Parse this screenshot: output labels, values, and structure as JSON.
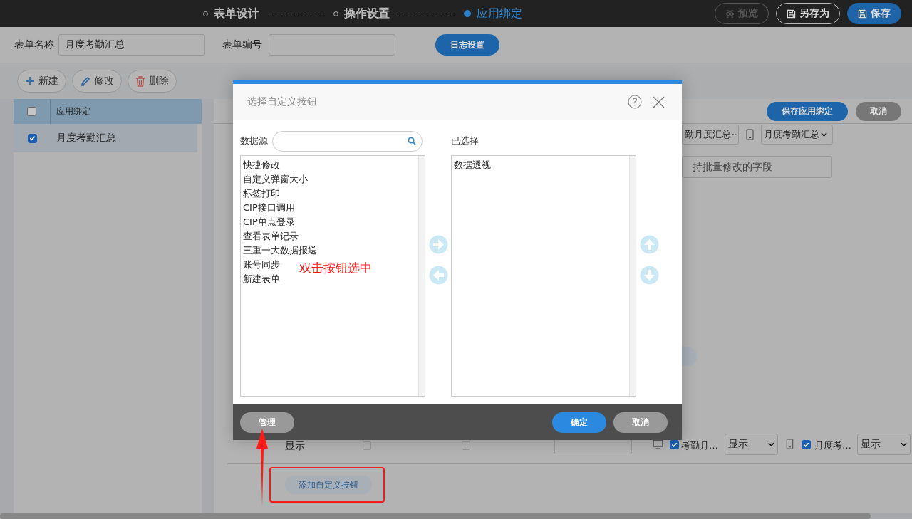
{
  "steps": [
    {
      "label": "表单设计",
      "selected": false
    },
    {
      "label": "操作设置",
      "selected": false
    },
    {
      "label": "应用绑定",
      "selected": true
    }
  ],
  "top_buttons": [
    {
      "kind": "preview",
      "label": "预览",
      "disabled": true
    },
    {
      "kind": "save-as",
      "label": "另存为",
      "disabled": false
    },
    {
      "kind": "save",
      "label": "保存",
      "disabled": false
    }
  ],
  "form": {
    "name_label": "表单名称",
    "name_value": "月度考勤汇总",
    "code_label": "表单编号",
    "log_button": "日志设置"
  },
  "toolbar": [
    {
      "kind": "add",
      "label": "新建"
    },
    {
      "kind": "edit",
      "label": "修改"
    },
    {
      "kind": "delete",
      "label": "删除"
    }
  ],
  "list": {
    "header": "应用绑定",
    "header_checked": false,
    "rows": [
      {
        "label": "月度考勤汇总",
        "checked": true
      }
    ]
  },
  "panel": {
    "buttons": [
      {
        "kind": "primary",
        "label": "保存应用绑定"
      },
      {
        "kind": "secondary",
        "label": "取消"
      }
    ],
    "pc_select": "勤月度汇总",
    "mobile_select": "月度考勤汇总",
    "batch_field": "持批量修改的字段",
    "row": {
      "label": "显示",
      "check_1": false,
      "check_2": false,
      "pc_checked": true,
      "pc_name": "考勤月…",
      "pc_display": "显示",
      "mobile_checked": true,
      "mobile_name": "月度考…",
      "mobile_display": "显示"
    },
    "add_button": "添加自定义按钮"
  },
  "dialog": {
    "title": "选择自定义按钮",
    "source_label": "数据源",
    "selected_label": "已选择",
    "source_items": [
      "快捷修改",
      "自定义弹窗大小",
      "标签打印",
      "CIP接口调用",
      "CIP单点登录",
      "查看表单记录",
      "三重一大数据报送",
      "账号同步",
      "新建表单"
    ],
    "selected_items": [
      "数据透视"
    ],
    "hint": "双击按钮选中",
    "manage": "管理",
    "ok": "确定",
    "cancel": "取消"
  }
}
